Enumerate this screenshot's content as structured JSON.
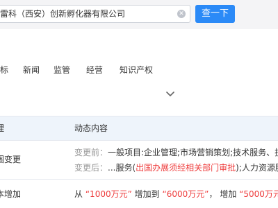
{
  "search": {
    "value": "雷科（西安）创新孵化器有限公司",
    "button_label": "查一下"
  },
  "tabs": [
    {
      "label": "标"
    },
    {
      "label": "新闻"
    },
    {
      "label": "监管"
    },
    {
      "label": "经营"
    },
    {
      "label": "知识产权"
    }
  ],
  "table": {
    "headers": [
      "理",
      "动态内容"
    ],
    "rows": [
      {
        "item": "围变更",
        "before_label": "变更前：",
        "before_text": "一般项目:企业管理;市场营销策划;技术服务、技",
        "after_label": "变更后：",
        "after_text_1": "...服务(",
        "after_highlight": "出国办展须经相关部门审批",
        "after_text_2": ");人力资源服"
      },
      {
        "item": "本增加",
        "from_word": "从",
        "from_value": "“1000万元”",
        "mid_word": "增加到",
        "to_value": "“6000万元”",
        "sep": "，",
        "add_word": "增加",
        "add_value": "“5000万元”"
      }
    ]
  },
  "colors": {
    "accent": "#2b8af7",
    "highlight": "#ee3b3b",
    "header_bg": "#f4f4f6",
    "table_head_bg": "#eef4fb"
  }
}
